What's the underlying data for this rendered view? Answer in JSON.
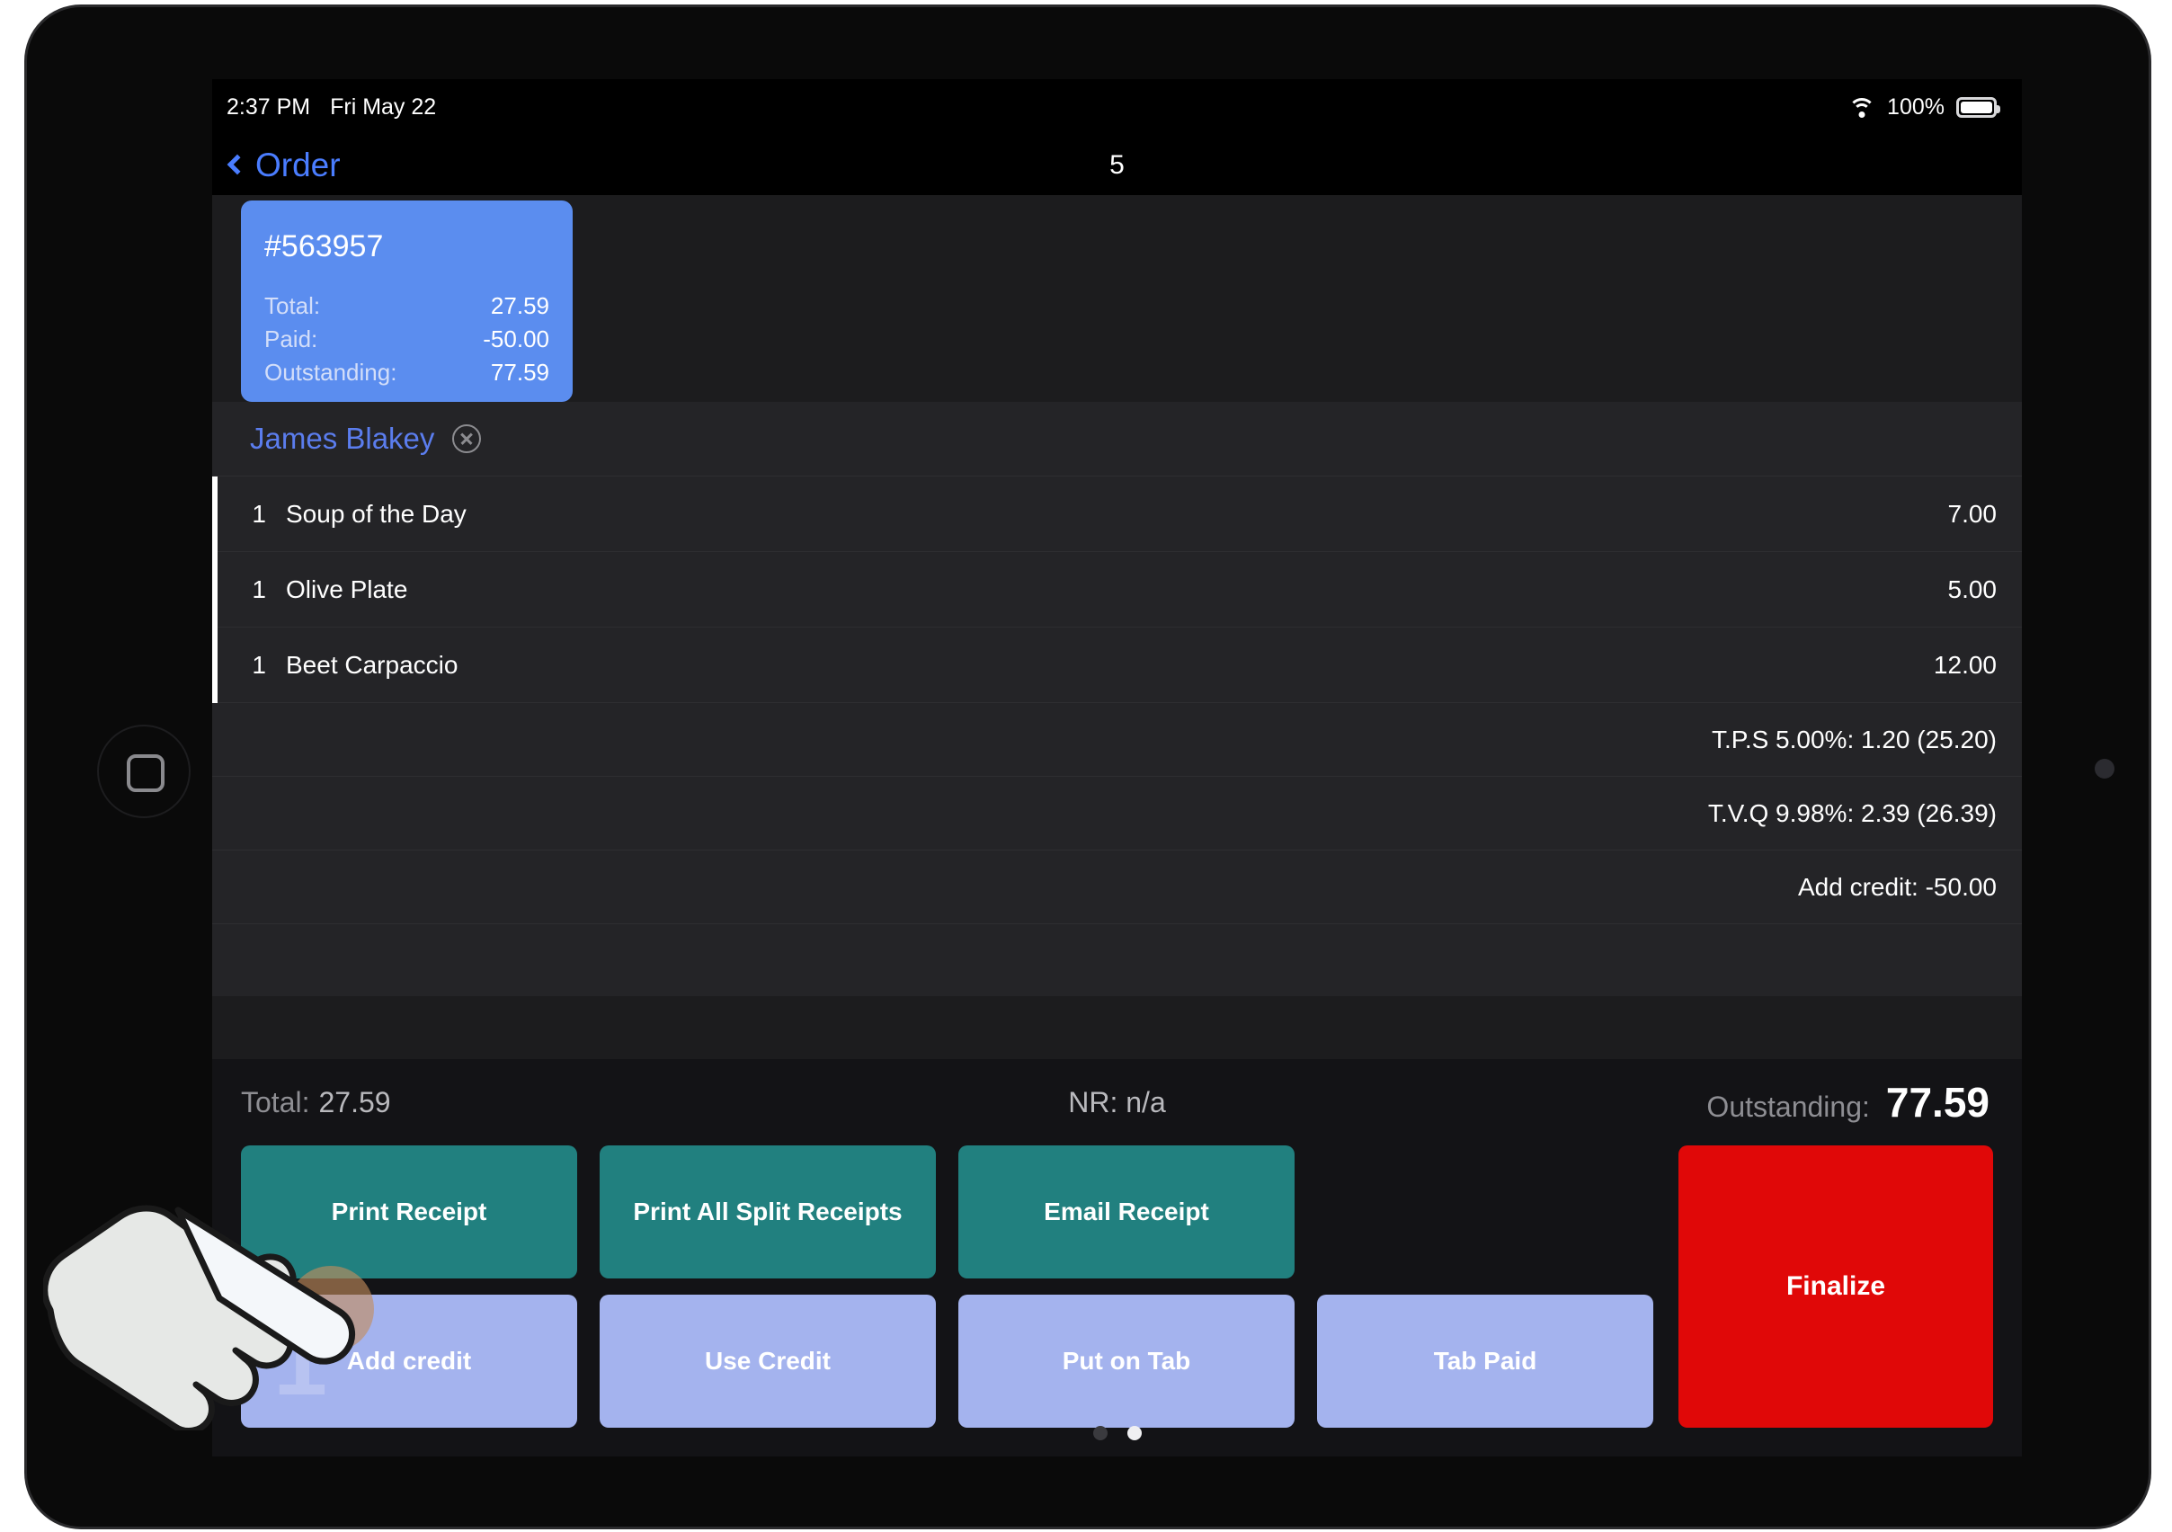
{
  "status_bar": {
    "time": "2:37 PM",
    "date": "Fri May 22",
    "battery_percent": "100%",
    "wifi_icon": "wifi-icon",
    "battery_icon": "battery-icon"
  },
  "nav": {
    "back_label": "Order",
    "back_icon": "chevron-left-icon",
    "title": "5"
  },
  "order_card": {
    "number": "#563957",
    "lines": [
      {
        "label": "Total:",
        "value": "27.59"
      },
      {
        "label": "Paid:",
        "value": "-50.00"
      },
      {
        "label": "Outstanding:",
        "value": "77.59"
      }
    ],
    "accent_color": "#5b8def"
  },
  "customer": {
    "name": "James Blakey",
    "remove_icon": "close-circle-icon"
  },
  "items": [
    {
      "qty": "1",
      "name": "Soup of the Day",
      "price": "7.00"
    },
    {
      "qty": "1",
      "name": "Olive Plate",
      "price": "5.00"
    },
    {
      "qty": "1",
      "name": "Beet Carpaccio",
      "price": "12.00"
    }
  ],
  "meta_rows": [
    {
      "text": "T.P.S 5.00%: 1.20 (25.20)"
    },
    {
      "text": "T.V.Q 9.98%: 2.39 (26.39)"
    },
    {
      "text": "Add credit: -50.00"
    }
  ],
  "footer": {
    "total_label": "Total:",
    "total_value": "27.59",
    "nr_text": "NR: n/a",
    "outstanding_label": "Outstanding:",
    "outstanding_value": "77.59"
  },
  "buttons": {
    "row1": [
      {
        "label": "Print Receipt",
        "color": "#21807f"
      },
      {
        "label": "Print All Split Receipts",
        "color": "#21807f"
      },
      {
        "label": "Email Receipt",
        "color": "#21807f"
      }
    ],
    "row2": [
      {
        "label": "Add credit",
        "color": "#a4b3ee",
        "ghost_number": "1"
      },
      {
        "label": "Use Credit",
        "color": "#a4b3ee"
      },
      {
        "label": "Put on Tab",
        "color": "#a4b3ee"
      },
      {
        "label": "Tab Paid",
        "color": "#a4b3ee"
      }
    ],
    "finalize": {
      "label": "Finalize",
      "color": "#e00808"
    }
  },
  "pagination": {
    "count": 2,
    "active_index": 1
  },
  "device": {
    "home_button_icon": "home-square-icon",
    "camera_icon": "front-camera-icon",
    "cursor_icon": "pointing-hand-cursor"
  }
}
